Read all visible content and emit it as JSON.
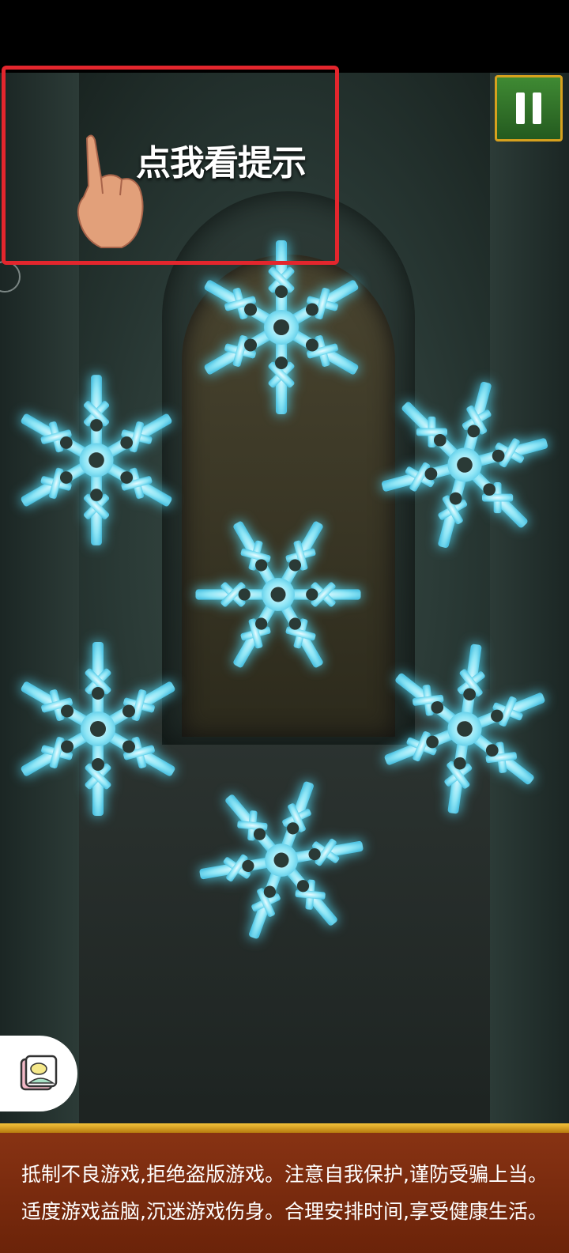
{
  "hint": {
    "label": "点我看提示"
  },
  "notice": {
    "line1": "抵制不良游戏,拒绝盗版游戏。注意自我保护,谨防受骗上当。",
    "line2": "适度游戏益脑,沉迷游戏伤身。合理安排时间,享受健康生活。"
  },
  "colors": {
    "snowflake": "#7fe6f5",
    "hint_border": "#e3262d",
    "pause_bg": "#3f8a33",
    "footer_bg": "#7a2b0e"
  },
  "icons": {
    "pause": "pause-icon",
    "hand": "pointing-hand-icon",
    "gallery": "photo-gallery-icon"
  }
}
